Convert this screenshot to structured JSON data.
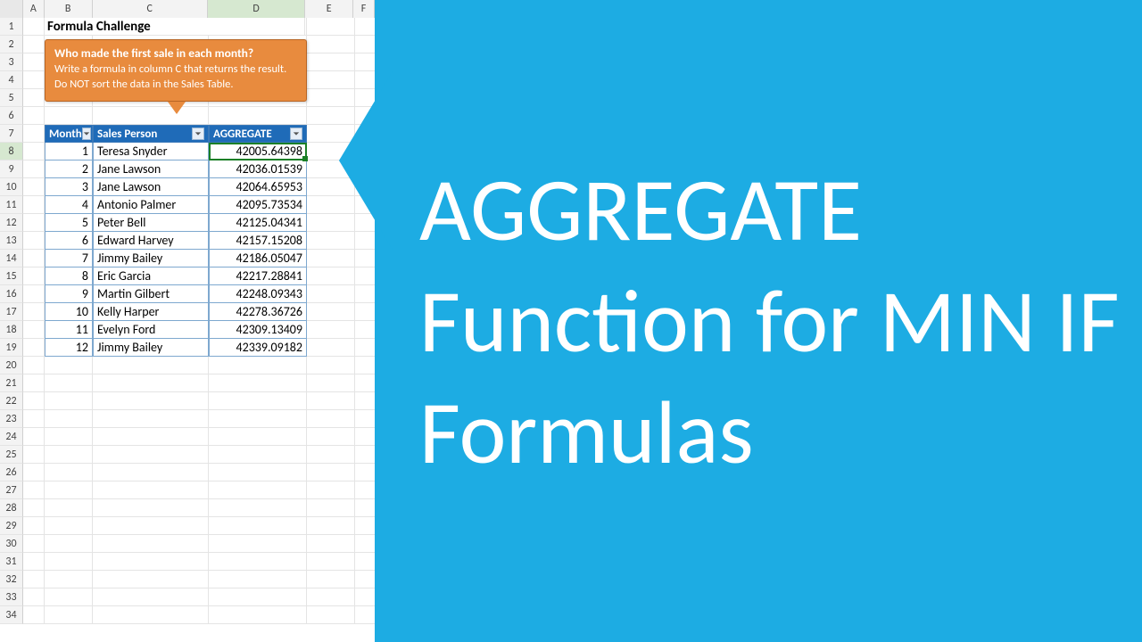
{
  "columns": [
    "A",
    "B",
    "C",
    "D",
    "E",
    "F"
  ],
  "col_widths": {
    "A": 24,
    "B": 54,
    "C": 130,
    "D": 110,
    "E": 54,
    "F": 24
  },
  "active_col": "D",
  "active_row": 8,
  "title": "Formula Challenge",
  "callout": {
    "heading": "Who made the first sale in each month?",
    "line1": "Write a formula in column C that returns the result.",
    "line2": "Do NOT sort the data in the Sales Table."
  },
  "table": {
    "headers": {
      "month": "Month",
      "person": "Sales Person",
      "agg": "AGGREGATE"
    },
    "rows": [
      {
        "month": 1,
        "person": "Teresa Snyder",
        "agg": "42005.64398"
      },
      {
        "month": 2,
        "person": "Jane Lawson",
        "agg": "42036.01539"
      },
      {
        "month": 3,
        "person": "Jane Lawson",
        "agg": "42064.65953"
      },
      {
        "month": 4,
        "person": "Antonio Palmer",
        "agg": "42095.73534"
      },
      {
        "month": 5,
        "person": "Peter Bell",
        "agg": "42125.04341"
      },
      {
        "month": 6,
        "person": "Edward Harvey",
        "agg": "42157.15208"
      },
      {
        "month": 7,
        "person": "Jimmy Bailey",
        "agg": "42186.05047"
      },
      {
        "month": 8,
        "person": "Eric Garcia",
        "agg": "42217.28841"
      },
      {
        "month": 9,
        "person": "Martin Gilbert",
        "agg": "42248.09343"
      },
      {
        "month": 10,
        "person": "Kelly Harper",
        "agg": "42278.36726"
      },
      {
        "month": 11,
        "person": "Evelyn Ford",
        "agg": "42309.13409"
      },
      {
        "month": 12,
        "person": "Jimmy Bailey",
        "agg": "42339.09182"
      }
    ]
  },
  "right_panel_text": "AGGREGATE Function for MIN IF Formulas",
  "row_count": 34
}
